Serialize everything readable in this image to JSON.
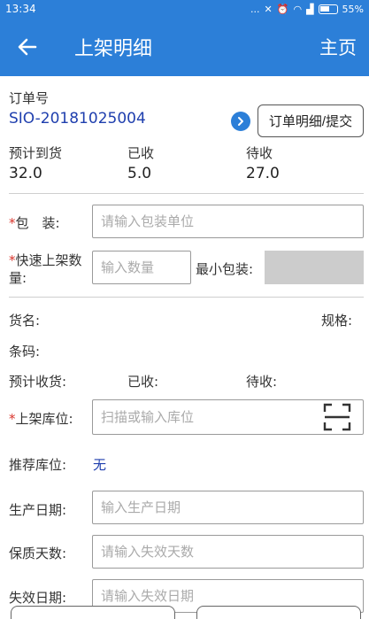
{
  "status": {
    "time": "13:34",
    "dots": "...",
    "battery": "55%"
  },
  "header": {
    "title": "上架明细",
    "home_label": "主页"
  },
  "order": {
    "label": "订单号",
    "number": "SIO-20181025004",
    "detail_button": "订单明细/提交"
  },
  "quantities": [
    {
      "label": "预计到货",
      "value": "32.0"
    },
    {
      "label": "已收",
      "value": "5.0"
    },
    {
      "label": "待收",
      "value": "27.0"
    }
  ],
  "form": {
    "package": {
      "required_mark": "*",
      "label": "包　装:",
      "placeholder": "请输入包装单位"
    },
    "quick_qty": {
      "required_mark": "*",
      "label_line1": "快速上架数",
      "label_line2": "量:",
      "placeholder": "输入数量",
      "min_pack_label": "最小包装:"
    },
    "goods_name_label": "货名:",
    "spec_label": "规格:",
    "barcode_label": "条码:",
    "expected_label": "预计收货:",
    "received_label": "已收:",
    "pending_label": "待收:",
    "location": {
      "required_mark": "*",
      "label": "上架库位:",
      "placeholder": "扫描或输入库位"
    },
    "recommended": {
      "label": "推荐库位:",
      "value": "无"
    },
    "production_date": {
      "label": "生产日期:",
      "placeholder": "输入生产日期"
    },
    "shelf_life": {
      "label": "保质天数:",
      "placeholder": "请输入失效天数"
    },
    "expiry_date": {
      "label": "失效日期:",
      "placeholder": "请输入失效日期"
    }
  },
  "colors": {
    "primary": "#2c7fd8",
    "link": "#1f3fae",
    "required": "#d9352c"
  }
}
